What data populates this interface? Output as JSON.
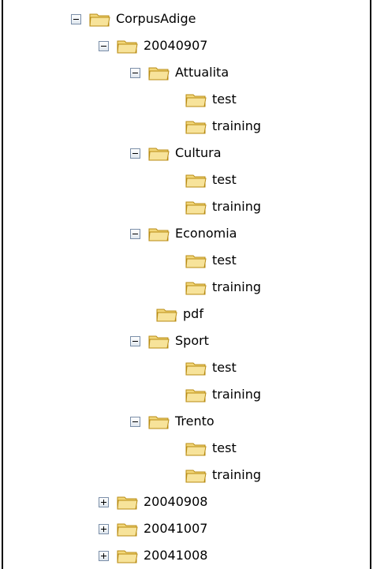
{
  "tree": {
    "corpus": {
      "label": "CorpusAdige",
      "toggle": "minus"
    },
    "d20040907": {
      "label": "20040907",
      "toggle": "minus",
      "attualita": {
        "label": "Attualita",
        "toggle": "minus",
        "test": "test",
        "training": "training"
      },
      "cultura": {
        "label": "Cultura",
        "toggle": "minus",
        "test": "test",
        "training": "training"
      },
      "economia": {
        "label": "Economia",
        "toggle": "minus",
        "test": "test",
        "training": "training"
      },
      "pdf": {
        "label": "pdf"
      },
      "sport": {
        "label": "Sport",
        "toggle": "minus",
        "test": "test",
        "training": "training"
      },
      "trento": {
        "label": "Trento",
        "toggle": "minus",
        "test": "test",
        "training": "training"
      }
    },
    "d20040908": {
      "label": "20040908",
      "toggle": "plus"
    },
    "d20041007": {
      "label": "20041007",
      "toggle": "plus"
    },
    "d20041008": {
      "label": "20041008",
      "toggle": "plus"
    }
  },
  "icons": {
    "folder": "folder-icon",
    "expanded": "minus-box-icon",
    "collapsed": "plus-box-icon"
  },
  "colors": {
    "folder_fill": "#f2d77a",
    "folder_stroke": "#b88b12",
    "toggle_border": "#7a8ea8",
    "text": "#000000",
    "background": "#ffffff"
  }
}
